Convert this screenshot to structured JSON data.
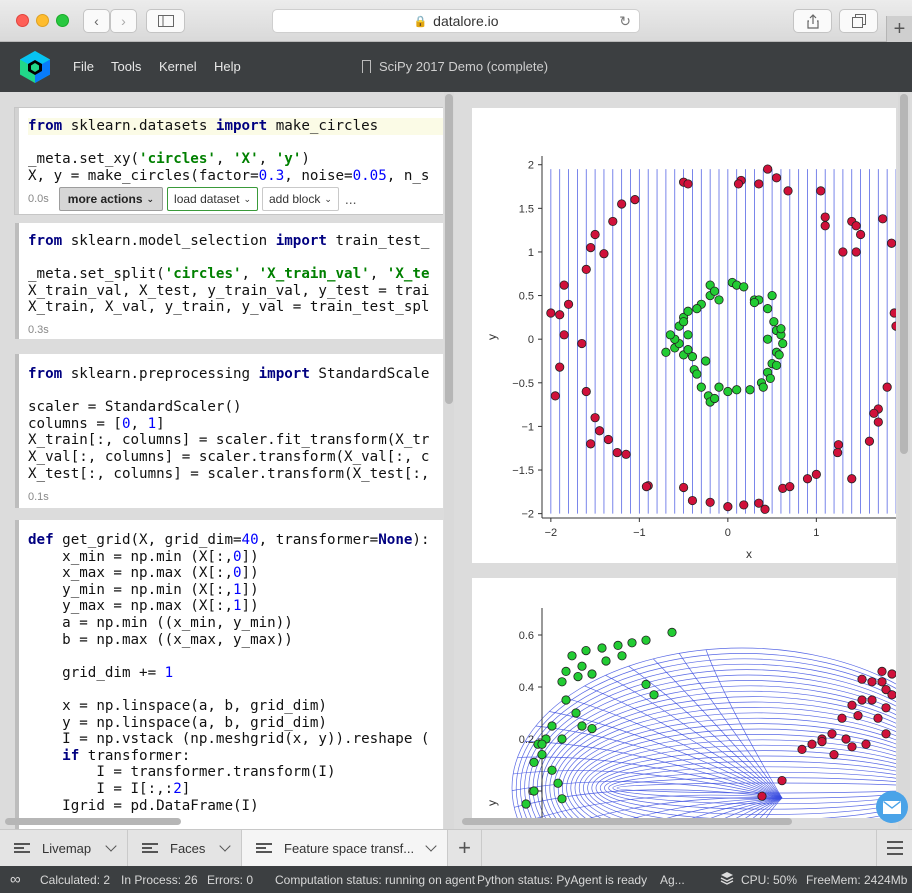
{
  "browser": {
    "url": "datalore.io",
    "icons": [
      "back-arrow-icon",
      "forward-arrow-icon",
      "sidebar-icon",
      "lock-icon",
      "reload-icon",
      "share-icon",
      "tabs-icon",
      "plus-icon"
    ],
    "new_tab_label": "+"
  },
  "app": {
    "menu": [
      "File",
      "Tools",
      "Kernel",
      "Help"
    ],
    "document_title": "SciPy 2017 Demo (complete)",
    "colors": {
      "header_bg": "#3c3f41",
      "green_point": "#22cc33",
      "red_point": "#d0113a",
      "grid_line": "#3b4de0"
    }
  },
  "cells": [
    {
      "timing": "0.0s",
      "toolbar": {
        "more_actions": "more actions",
        "load_dataset": "load dataset",
        "add_block": "add block",
        "ellipsis": "..."
      }
    },
    {
      "timing": "0.3s"
    },
    {
      "timing": "0.1s"
    },
    {
      "timing": ""
    }
  ],
  "plots": {
    "x_label": "x",
    "y_label": "y",
    "x_ticks": [
      "−2",
      "−1",
      "0",
      "1"
    ],
    "y_ticks": [
      "2",
      "1.5",
      "1",
      "0.5",
      "0",
      "−0.5",
      "−1",
      "−1.5",
      "−2"
    ],
    "y_ticks_bottom": [
      "0.6",
      "0.4",
      "0.2",
      "0"
    ]
  },
  "chart_data": [
    {
      "type": "scatter",
      "title": "",
      "xlabel": "x",
      "ylabel": "y",
      "xlim": [
        -2.1,
        1.9
      ],
      "ylim": [
        -2.05,
        2.1
      ],
      "grid": "vertical lines",
      "series": [
        {
          "color": "#d0113a",
          "points": [
            [
              -2.0,
              0.3
            ],
            [
              -1.9,
              0.28
            ],
            [
              -1.95,
              -0.65
            ],
            [
              -1.9,
              -0.32
            ],
            [
              -1.85,
              0.05
            ],
            [
              -1.85,
              0.62
            ],
            [
              -1.8,
              0.4
            ],
            [
              -1.65,
              -0.05
            ],
            [
              -1.6,
              0.8
            ],
            [
              -1.55,
              1.05
            ],
            [
              -1.5,
              1.2
            ],
            [
              -1.4,
              0.98
            ],
            [
              -1.3,
              1.35
            ],
            [
              -1.2,
              1.55
            ],
            [
              -1.05,
              1.6
            ],
            [
              -0.5,
              1.8
            ],
            [
              -0.45,
              1.78
            ],
            [
              -1.6,
              -0.6
            ],
            [
              -1.5,
              -0.9
            ],
            [
              -1.55,
              -1.2
            ],
            [
              -1.45,
              -1.05
            ],
            [
              -1.35,
              -1.15
            ],
            [
              -1.25,
              -1.3
            ],
            [
              -1.15,
              -1.32
            ],
            [
              -0.9,
              -1.68
            ],
            [
              -0.92,
              -1.69
            ],
            [
              -0.5,
              -1.7
            ],
            [
              -0.4,
              -1.85
            ],
            [
              -0.2,
              -1.87
            ],
            [
              0.0,
              -1.92
            ],
            [
              0.18,
              -1.9
            ],
            [
              0.35,
              -1.88
            ],
            [
              0.42,
              -1.95
            ],
            [
              0.62,
              -1.71
            ],
            [
              0.7,
              -1.69
            ],
            [
              0.15,
              1.82
            ],
            [
              0.12,
              1.78
            ],
            [
              0.45,
              1.95
            ],
            [
              0.55,
              1.85
            ],
            [
              0.35,
              1.78
            ],
            [
              0.68,
              1.7
            ],
            [
              1.05,
              1.7
            ],
            [
              1.1,
              1.4
            ],
            [
              1.1,
              1.3
            ],
            [
              1.4,
              1.35
            ],
            [
              1.45,
              1.3
            ],
            [
              1.75,
              1.38
            ],
            [
              1.85,
              1.1
            ],
            [
              1.88,
              0.3
            ],
            [
              1.9,
              0.15
            ],
            [
              1.8,
              -0.55
            ],
            [
              1.7,
              -0.8
            ],
            [
              1.65,
              -0.85
            ],
            [
              1.7,
              -0.95
            ],
            [
              1.6,
              -1.17
            ],
            [
              1.25,
              -1.21
            ],
            [
              1.24,
              -1.3
            ],
            [
              1.0,
              -1.55
            ],
            [
              1.4,
              -1.6
            ],
            [
              0.9,
              -1.6
            ],
            [
              1.45,
              1.0
            ],
            [
              1.3,
              1.0
            ],
            [
              1.5,
              1.2
            ]
          ]
        },
        {
          "color": "#22cc33",
          "points": [
            [
              -0.7,
              -0.15
            ],
            [
              -0.6,
              -0.1
            ],
            [
              -0.55,
              0.15
            ],
            [
              -0.5,
              0.25
            ],
            [
              -0.45,
              0.05
            ],
            [
              -0.4,
              -0.2
            ],
            [
              -0.38,
              -0.35
            ],
            [
              -0.35,
              -0.4
            ],
            [
              -0.3,
              -0.55
            ],
            [
              -0.22,
              -0.65
            ],
            [
              -0.2,
              -0.72
            ],
            [
              -0.15,
              -0.68
            ],
            [
              -0.55,
              -0.05
            ],
            [
              -0.6,
              0.0
            ],
            [
              -0.65,
              0.05
            ],
            [
              -0.5,
              0.2
            ],
            [
              -0.45,
              0.32
            ],
            [
              -0.3,
              0.4
            ],
            [
              -0.2,
              0.5
            ],
            [
              -0.2,
              0.62
            ],
            [
              -0.15,
              0.55
            ],
            [
              -0.1,
              0.45
            ],
            [
              0.05,
              0.65
            ],
            [
              0.1,
              0.62
            ],
            [
              0.18,
              0.6
            ],
            [
              0.3,
              0.45
            ],
            [
              0.35,
              0.45
            ],
            [
              0.45,
              0.35
            ],
            [
              0.5,
              0.5
            ],
            [
              0.52,
              0.2
            ],
            [
              0.55,
              0.1
            ],
            [
              0.6,
              0.05
            ],
            [
              0.62,
              -0.05
            ],
            [
              0.55,
              -0.15
            ],
            [
              0.5,
              -0.28
            ],
            [
              0.45,
              -0.38
            ],
            [
              0.38,
              -0.5
            ],
            [
              0.25,
              -0.58
            ],
            [
              0.1,
              -0.58
            ],
            [
              0.0,
              -0.6
            ],
            [
              -0.1,
              -0.55
            ],
            [
              0.45,
              0.0
            ],
            [
              0.58,
              -0.18
            ],
            [
              0.55,
              -0.3
            ],
            [
              0.48,
              -0.45
            ],
            [
              0.4,
              -0.55
            ],
            [
              -0.5,
              -0.18
            ],
            [
              -0.45,
              -0.12
            ],
            [
              -0.25,
              -0.25
            ],
            [
              -0.35,
              0.35
            ],
            [
              0.3,
              0.42
            ],
            [
              0.6,
              0.12
            ]
          ]
        }
      ]
    },
    {
      "type": "scatter",
      "title": "",
      "xlabel": "",
      "ylabel": "y",
      "ylim": [
        -0.05,
        0.65
      ],
      "grid": "warped mesh",
      "series": [
        {
          "color": "#22cc33",
          "points": [
            [
              0.05,
              0.52
            ],
            [
              0.12,
              0.54
            ],
            [
              0.2,
              0.55
            ],
            [
              0.28,
              0.56
            ],
            [
              0.35,
              0.57
            ],
            [
              0.42,
              0.58
            ],
            [
              0.55,
              0.61
            ],
            [
              0.3,
              0.52
            ],
            [
              0.22,
              0.5
            ],
            [
              0.1,
              0.48
            ],
            [
              0.02,
              0.46
            ],
            [
              0.0,
              0.42
            ],
            [
              0.08,
              0.44
            ],
            [
              0.15,
              0.45
            ],
            [
              0.42,
              0.41
            ],
            [
              0.46,
              0.37
            ],
            [
              0.02,
              0.35
            ],
            [
              0.07,
              0.3
            ],
            [
              0.1,
              0.25
            ],
            [
              0.15,
              0.24
            ],
            [
              0.0,
              0.2
            ],
            [
              -0.05,
              0.25
            ],
            [
              -0.08,
              0.2
            ],
            [
              -0.12,
              0.18
            ],
            [
              -0.1,
              0.14
            ],
            [
              -0.14,
              0.11
            ],
            [
              -0.05,
              0.08
            ],
            [
              -0.02,
              0.03
            ],
            [
              0.0,
              -0.03
            ],
            [
              -0.14,
              0.0
            ],
            [
              -0.18,
              -0.05
            ],
            [
              -0.1,
              0.18
            ]
          ]
        },
        {
          "color": "#d0113a",
          "points": [
            [
              1.5,
              0.43
            ],
            [
              1.55,
              0.42
            ],
            [
              1.6,
              0.42
            ],
            [
              1.62,
              0.39
            ],
            [
              1.65,
              0.37
            ],
            [
              1.55,
              0.35
            ],
            [
              1.5,
              0.35
            ],
            [
              1.45,
              0.33
            ],
            [
              1.62,
              0.32
            ],
            [
              1.48,
              0.29
            ],
            [
              1.58,
              0.28
            ],
            [
              1.4,
              0.28
            ],
            [
              1.35,
              0.22
            ],
            [
              1.3,
              0.2
            ],
            [
              1.3,
              0.19
            ],
            [
              1.25,
              0.18
            ],
            [
              1.42,
              0.2
            ],
            [
              1.62,
              0.22
            ],
            [
              1.2,
              0.16
            ],
            [
              1.52,
              0.18
            ],
            [
              1.45,
              0.17
            ],
            [
              1.36,
              0.14
            ],
            [
              1.1,
              0.04
            ],
            [
              1.0,
              -0.02
            ],
            [
              1.6,
              0.46
            ],
            [
              1.65,
              0.45
            ]
          ]
        }
      ]
    }
  ],
  "tabs": [
    {
      "label": "Livemap"
    },
    {
      "label": "Faces"
    },
    {
      "label": "Feature space transf..."
    }
  ],
  "status": {
    "calculated": "Calculated: 2",
    "in_process": "In Process: 26",
    "errors": "Errors: 0",
    "computation": "Computation status: running on agent",
    "python": "Python status: PyAgent is ready",
    "agent": "Ag...",
    "cpu": "CPU: 50%",
    "freemem": "FreeMem: 2424Mb"
  }
}
